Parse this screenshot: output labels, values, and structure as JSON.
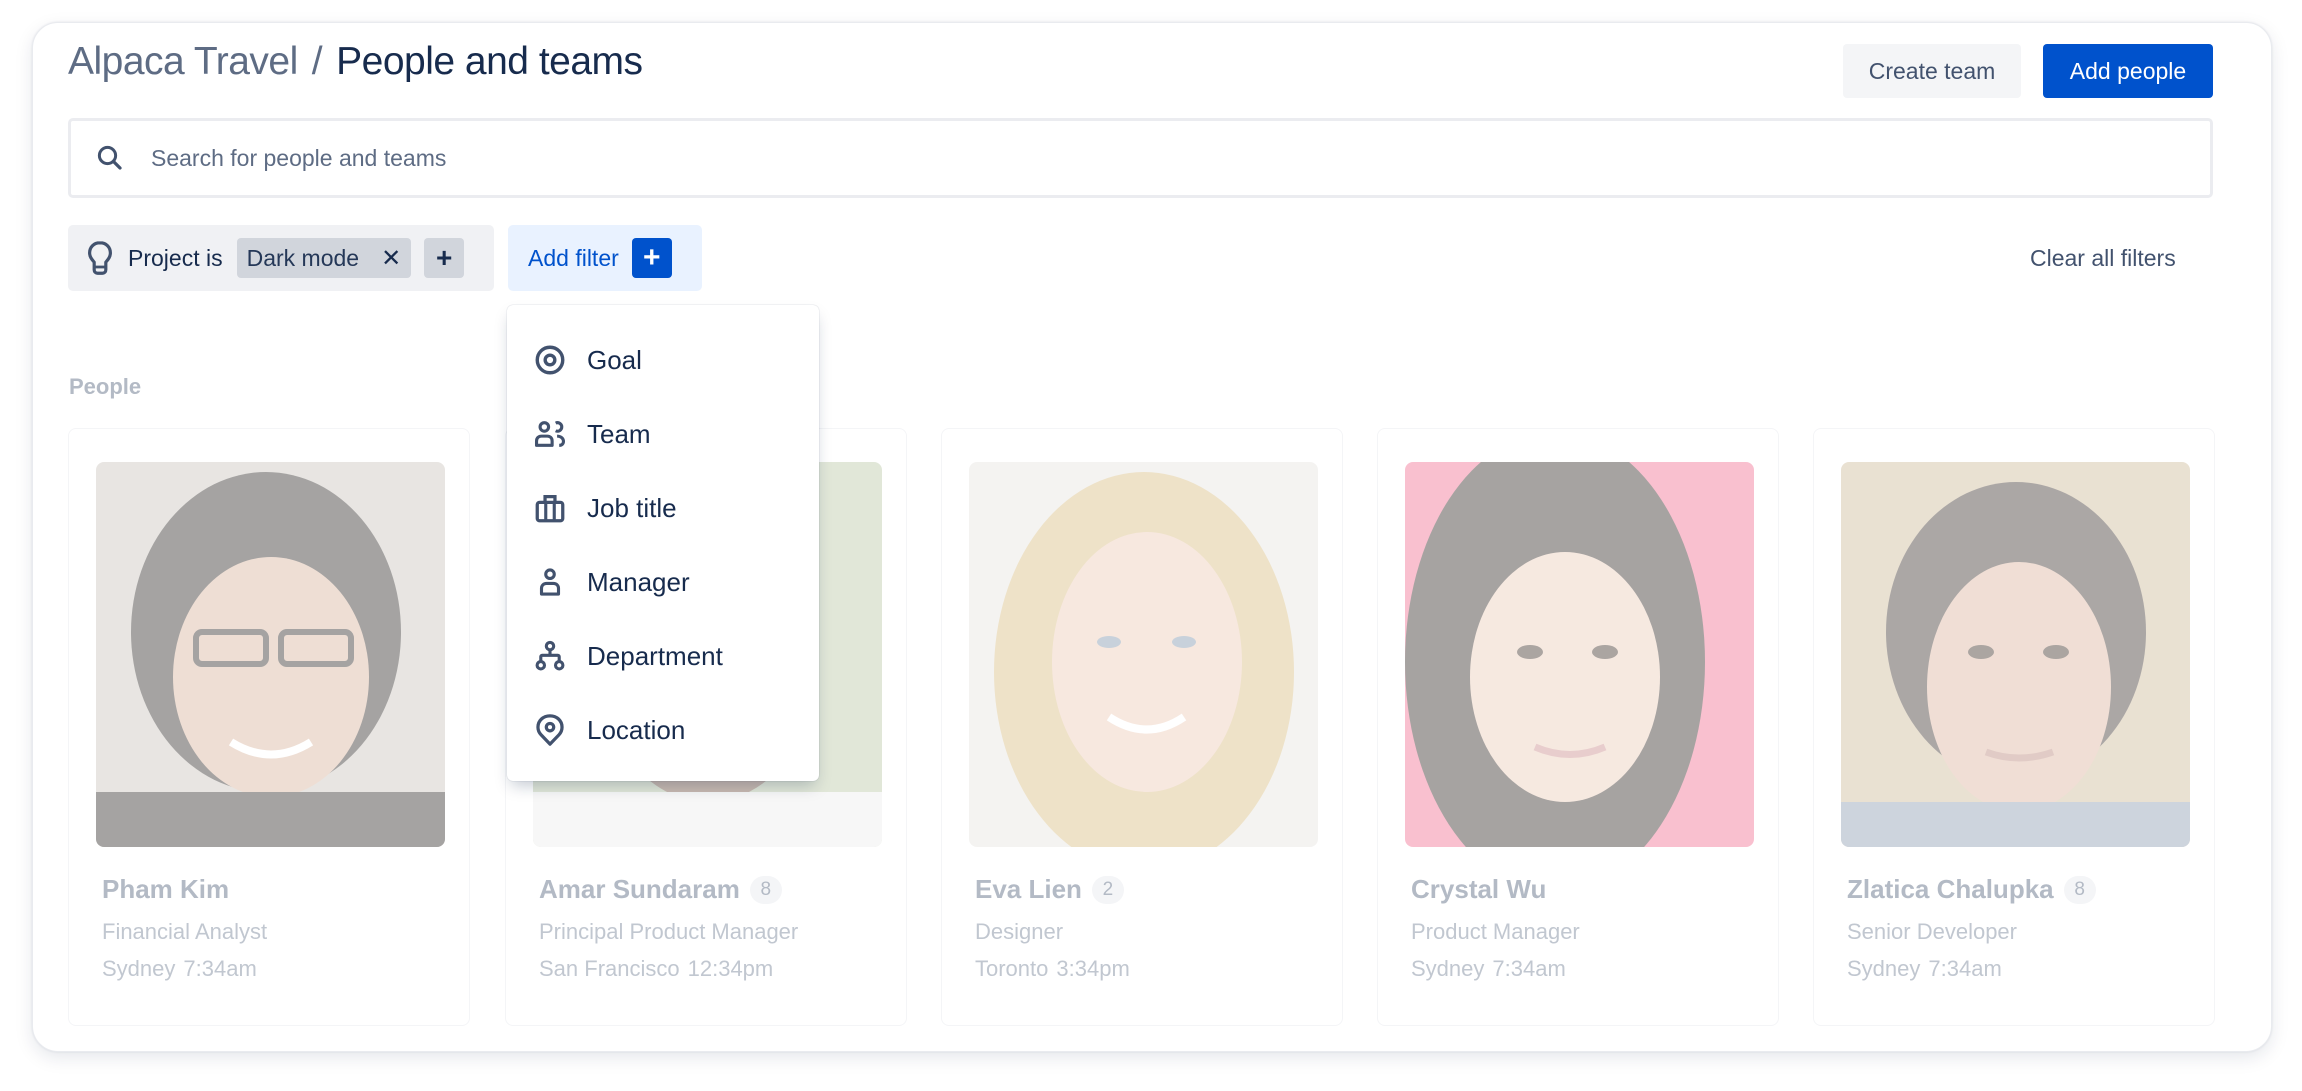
{
  "header": {
    "breadcrumb_parent": "Alpaca Travel",
    "breadcrumb_separator": "/",
    "page_title": "People and teams",
    "create_team_label": "Create team",
    "add_people_label": "Add people"
  },
  "search": {
    "placeholder": "Search for people and teams",
    "value": "",
    "icon": "search-icon"
  },
  "filters": {
    "active": {
      "icon": "lightbulb-icon",
      "field_label": "Project is",
      "value": "Dark mode",
      "remove_icon": "close-icon",
      "add_value_icon": "plus-icon"
    },
    "add_filter_label": "Add filter",
    "clear_all_label": "Clear all filters"
  },
  "filter_menu": {
    "items": [
      {
        "label": "Goal",
        "icon": "goal-icon"
      },
      {
        "label": "Team",
        "icon": "team-icon"
      },
      {
        "label": "Job title",
        "icon": "briefcase-icon"
      },
      {
        "label": "Manager",
        "icon": "person-icon"
      },
      {
        "label": "Department",
        "icon": "hierarchy-icon"
      },
      {
        "label": "Location",
        "icon": "location-pin-icon"
      }
    ]
  },
  "people": {
    "section_label": "People",
    "cards": [
      {
        "name": "Pham Kim",
        "badge": "",
        "role": "Financial Analyst",
        "city": "Sydney",
        "time": "7:34am"
      },
      {
        "name": "Amar Sundaram",
        "badge": "8",
        "role": "Principal Product Manager",
        "city": "San Francisco",
        "time": "12:34pm"
      },
      {
        "name": "Eva Lien",
        "badge": "2",
        "role": "Designer",
        "city": "Toronto",
        "time": "3:34pm"
      },
      {
        "name": "Crystal Wu",
        "badge": "",
        "role": "Product Manager",
        "city": "Sydney",
        "time": "7:34am"
      },
      {
        "name": "Zlatica Chalupka",
        "badge": "8",
        "role": "Senior Developer",
        "city": "Sydney",
        "time": "7:34am"
      }
    ]
  },
  "colors": {
    "primary": "#0052CC",
    "text_dark": "#172B4D",
    "text_subtle": "#5E6C84",
    "filter_bg": "#F0F1F4",
    "add_filter_bg": "#E9F2FF",
    "muted_text": "#B3BAC5"
  }
}
